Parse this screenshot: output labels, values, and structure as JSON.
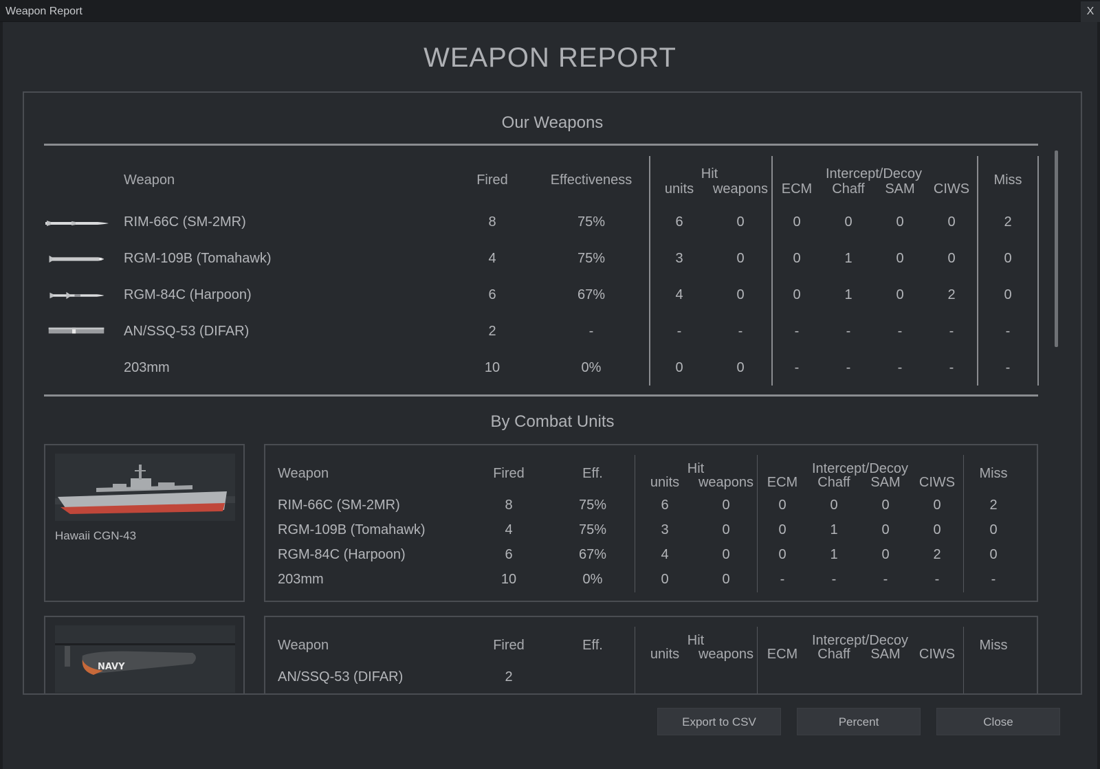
{
  "window": {
    "title": "Weapon Report",
    "close_label": "X"
  },
  "report": {
    "title": "WEAPON REPORT"
  },
  "our_weapons": {
    "title": "Our Weapons",
    "headers": {
      "weapon": "Weapon",
      "fired": "Fired",
      "effectiveness": "Effectiveness",
      "hit": "Hit",
      "units": "units",
      "weapons": "weapons",
      "ecm": "ECM",
      "intercept": "Intercept/Decoy",
      "chaff": "Chaff",
      "sam": "SAM",
      "ciws": "CIWS",
      "miss": "Miss"
    },
    "rows": [
      {
        "weapon": "RIM-66C (SM-2MR)",
        "fired": "8",
        "eff": "75%",
        "units": "6",
        "weapons": "0",
        "ecm": "0",
        "chaff": "0",
        "sam": "0",
        "ciws": "0",
        "miss": "2"
      },
      {
        "weapon": "RGM-109B (Tomahawk)",
        "fired": "4",
        "eff": "75%",
        "units": "3",
        "weapons": "0",
        "ecm": "0",
        "chaff": "1",
        "sam": "0",
        "ciws": "0",
        "miss": "0"
      },
      {
        "weapon": "RGM-84C (Harpoon)",
        "fired": "6",
        "eff": "67%",
        "units": "4",
        "weapons": "0",
        "ecm": "0",
        "chaff": "1",
        "sam": "0",
        "ciws": "2",
        "miss": "0"
      },
      {
        "weapon": "AN/SSQ-53 (DIFAR)",
        "fired": "2",
        "eff": "-",
        "units": "-",
        "weapons": "-",
        "ecm": "-",
        "chaff": "-",
        "sam": "-",
        "ciws": "-",
        "miss": "-"
      },
      {
        "weapon": "203mm",
        "fired": "10",
        "eff": "0%",
        "units": "0",
        "weapons": "0",
        "ecm": "-",
        "chaff": "-",
        "sam": "-",
        "ciws": "-",
        "miss": "-"
      }
    ]
  },
  "by_units": {
    "title": "By Combat Units",
    "headers": {
      "weapon": "Weapon",
      "fired": "Fired",
      "eff": "Eff.",
      "hit": "Hit",
      "units": "units",
      "weapons": "weapons",
      "ecm": "ECM",
      "intercept": "Intercept/Decoy",
      "chaff": "Chaff",
      "sam": "SAM",
      "ciws": "CIWS",
      "miss": "Miss"
    },
    "units": [
      {
        "name": "Hawaii CGN-43",
        "rows": [
          {
            "weapon": "RIM-66C (SM-2MR)",
            "fired": "8",
            "eff": "75%",
            "units": "6",
            "weapons": "0",
            "ecm": "0",
            "chaff": "0",
            "sam": "0",
            "ciws": "0",
            "miss": "2"
          },
          {
            "weapon": "RGM-109B (Tomahawk)",
            "fired": "4",
            "eff": "75%",
            "units": "3",
            "weapons": "0",
            "ecm": "0",
            "chaff": "1",
            "sam": "0",
            "ciws": "0",
            "miss": "0"
          },
          {
            "weapon": "RGM-84C (Harpoon)",
            "fired": "6",
            "eff": "67%",
            "units": "4",
            "weapons": "0",
            "ecm": "0",
            "chaff": "1",
            "sam": "0",
            "ciws": "2",
            "miss": "0"
          },
          {
            "weapon": "203mm",
            "fired": "10",
            "eff": "0%",
            "units": "0",
            "weapons": "0",
            "ecm": "-",
            "chaff": "-",
            "sam": "-",
            "ciws": "-",
            "miss": "-"
          }
        ]
      },
      {
        "name": "",
        "heli_marking": "NAVY",
        "rows": [
          {
            "weapon": "AN/SSQ-53 (DIFAR)",
            "fired": "2"
          }
        ]
      }
    ]
  },
  "buttons": {
    "export": "Export to CSV",
    "percent": "Percent",
    "close": "Close"
  },
  "colors": {
    "background": "#272a2e",
    "text": "#b4b6ba",
    "rule": "#8a8c90",
    "button": "#34373c"
  }
}
